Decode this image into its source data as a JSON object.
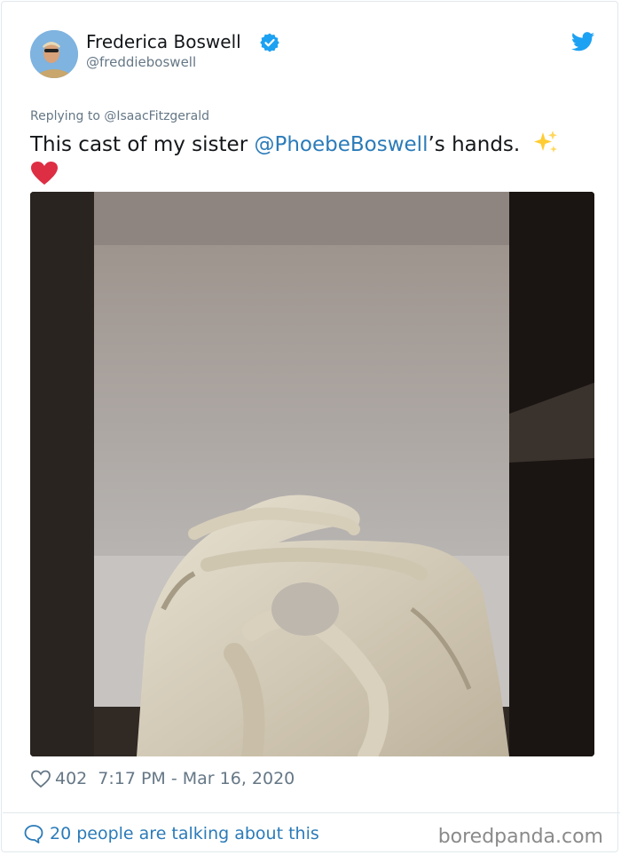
{
  "author": {
    "name": "Frederica Boswell",
    "handle": "@freddieboswell",
    "verified": true
  },
  "tweet": {
    "replying_to": "Replying to @IsaacFitzgerald",
    "text_before": "This cast of my sister ",
    "mention": "@PhoebeBoswell",
    "text_after": "’s hands. ",
    "emojis": [
      "sparkles-emoji",
      "red-heart-emoji"
    ]
  },
  "stats": {
    "likes": "402",
    "timestamp": "7:17 PM - Mar 16, 2020"
  },
  "footer": {
    "talking": "20 people are talking about this",
    "watermark": "boredpanda.com"
  },
  "colors": {
    "link": "#2b7bb9",
    "twitter_blue": "#1da1f2",
    "muted": "#657786",
    "heart": "#e0245e"
  }
}
